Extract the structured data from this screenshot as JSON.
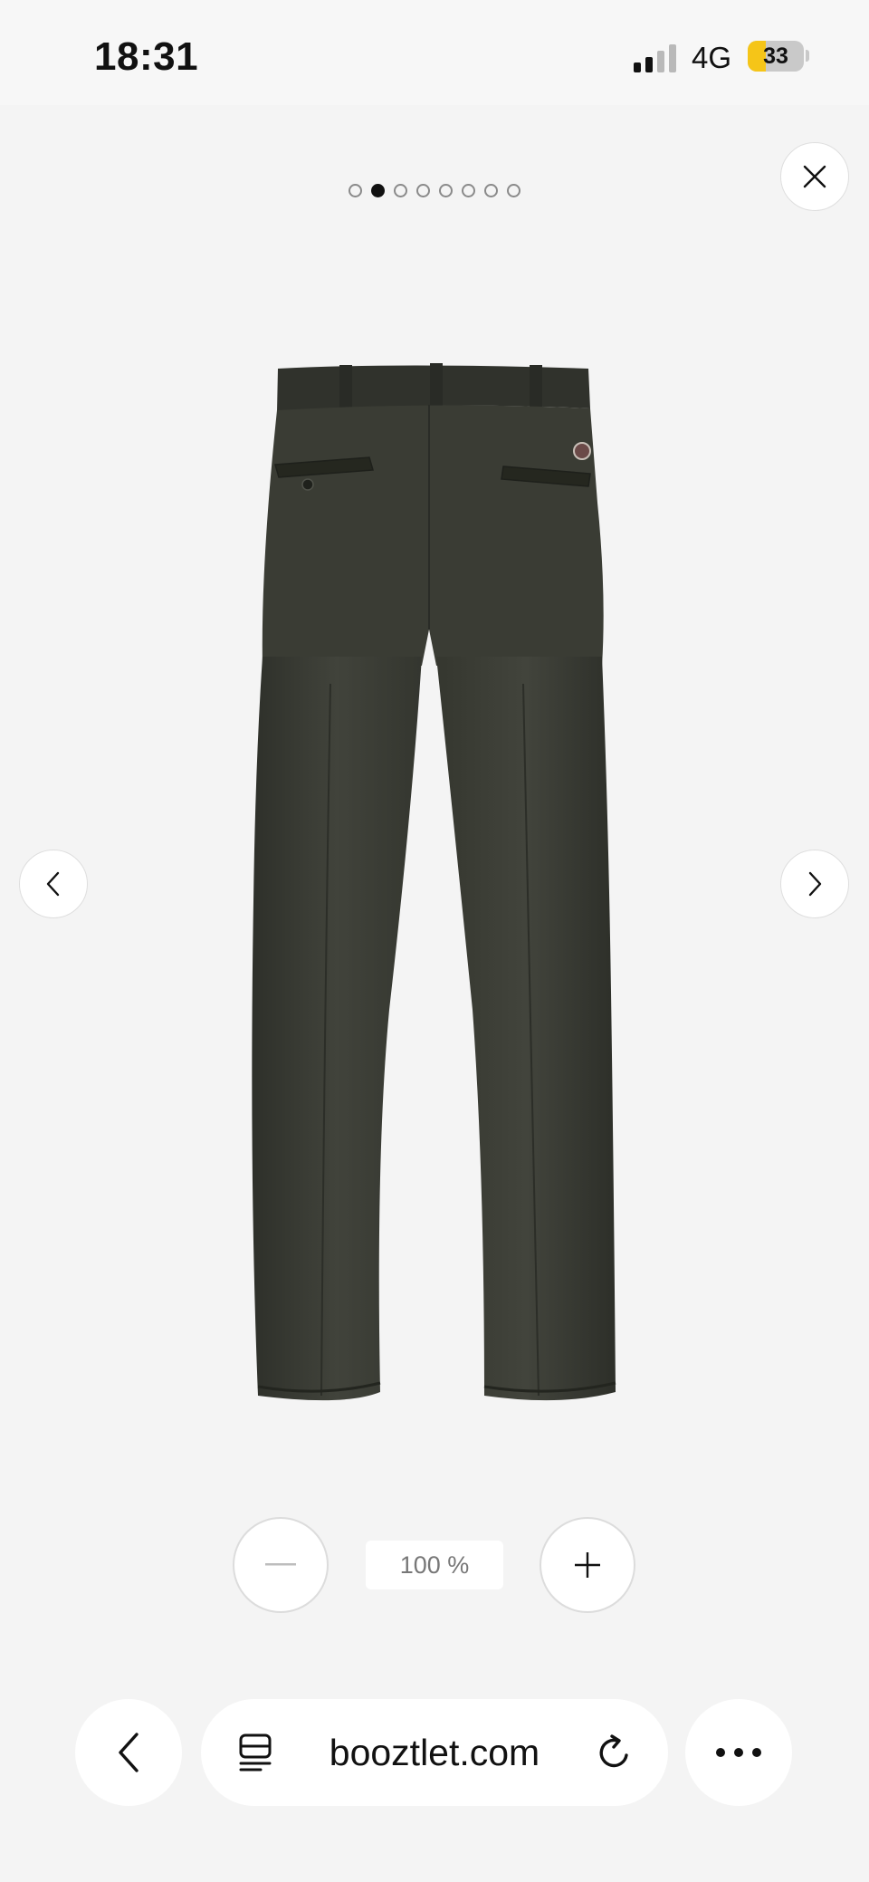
{
  "status_bar": {
    "time": "18:31",
    "network": "4G",
    "battery": "33",
    "battery_level": 0.33,
    "signal_bars_active": 2,
    "signal_bars_total": 4
  },
  "gallery": {
    "image_count": 8,
    "active_index": 1,
    "close_icon": "close-icon",
    "prev_icon": "chevron-left-icon",
    "next_icon": "chevron-right-icon",
    "product_image": "dark-olive-work-trousers-back-view"
  },
  "zoom": {
    "level": "100 %",
    "zoom_out_icon": "minus-icon",
    "zoom_in_icon": "plus-icon"
  },
  "browser_toolbar": {
    "url": "booztlet.com",
    "back_icon": "chevron-left-icon",
    "tabs_icon": "page-menu-icon",
    "reload_icon": "reload-icon",
    "more_icon": "more-icon"
  },
  "colors": {
    "background": "#f4f4f4",
    "fabric": "#3b3d35",
    "battery_accent": "#f5c518",
    "active_dot": "#111111"
  }
}
